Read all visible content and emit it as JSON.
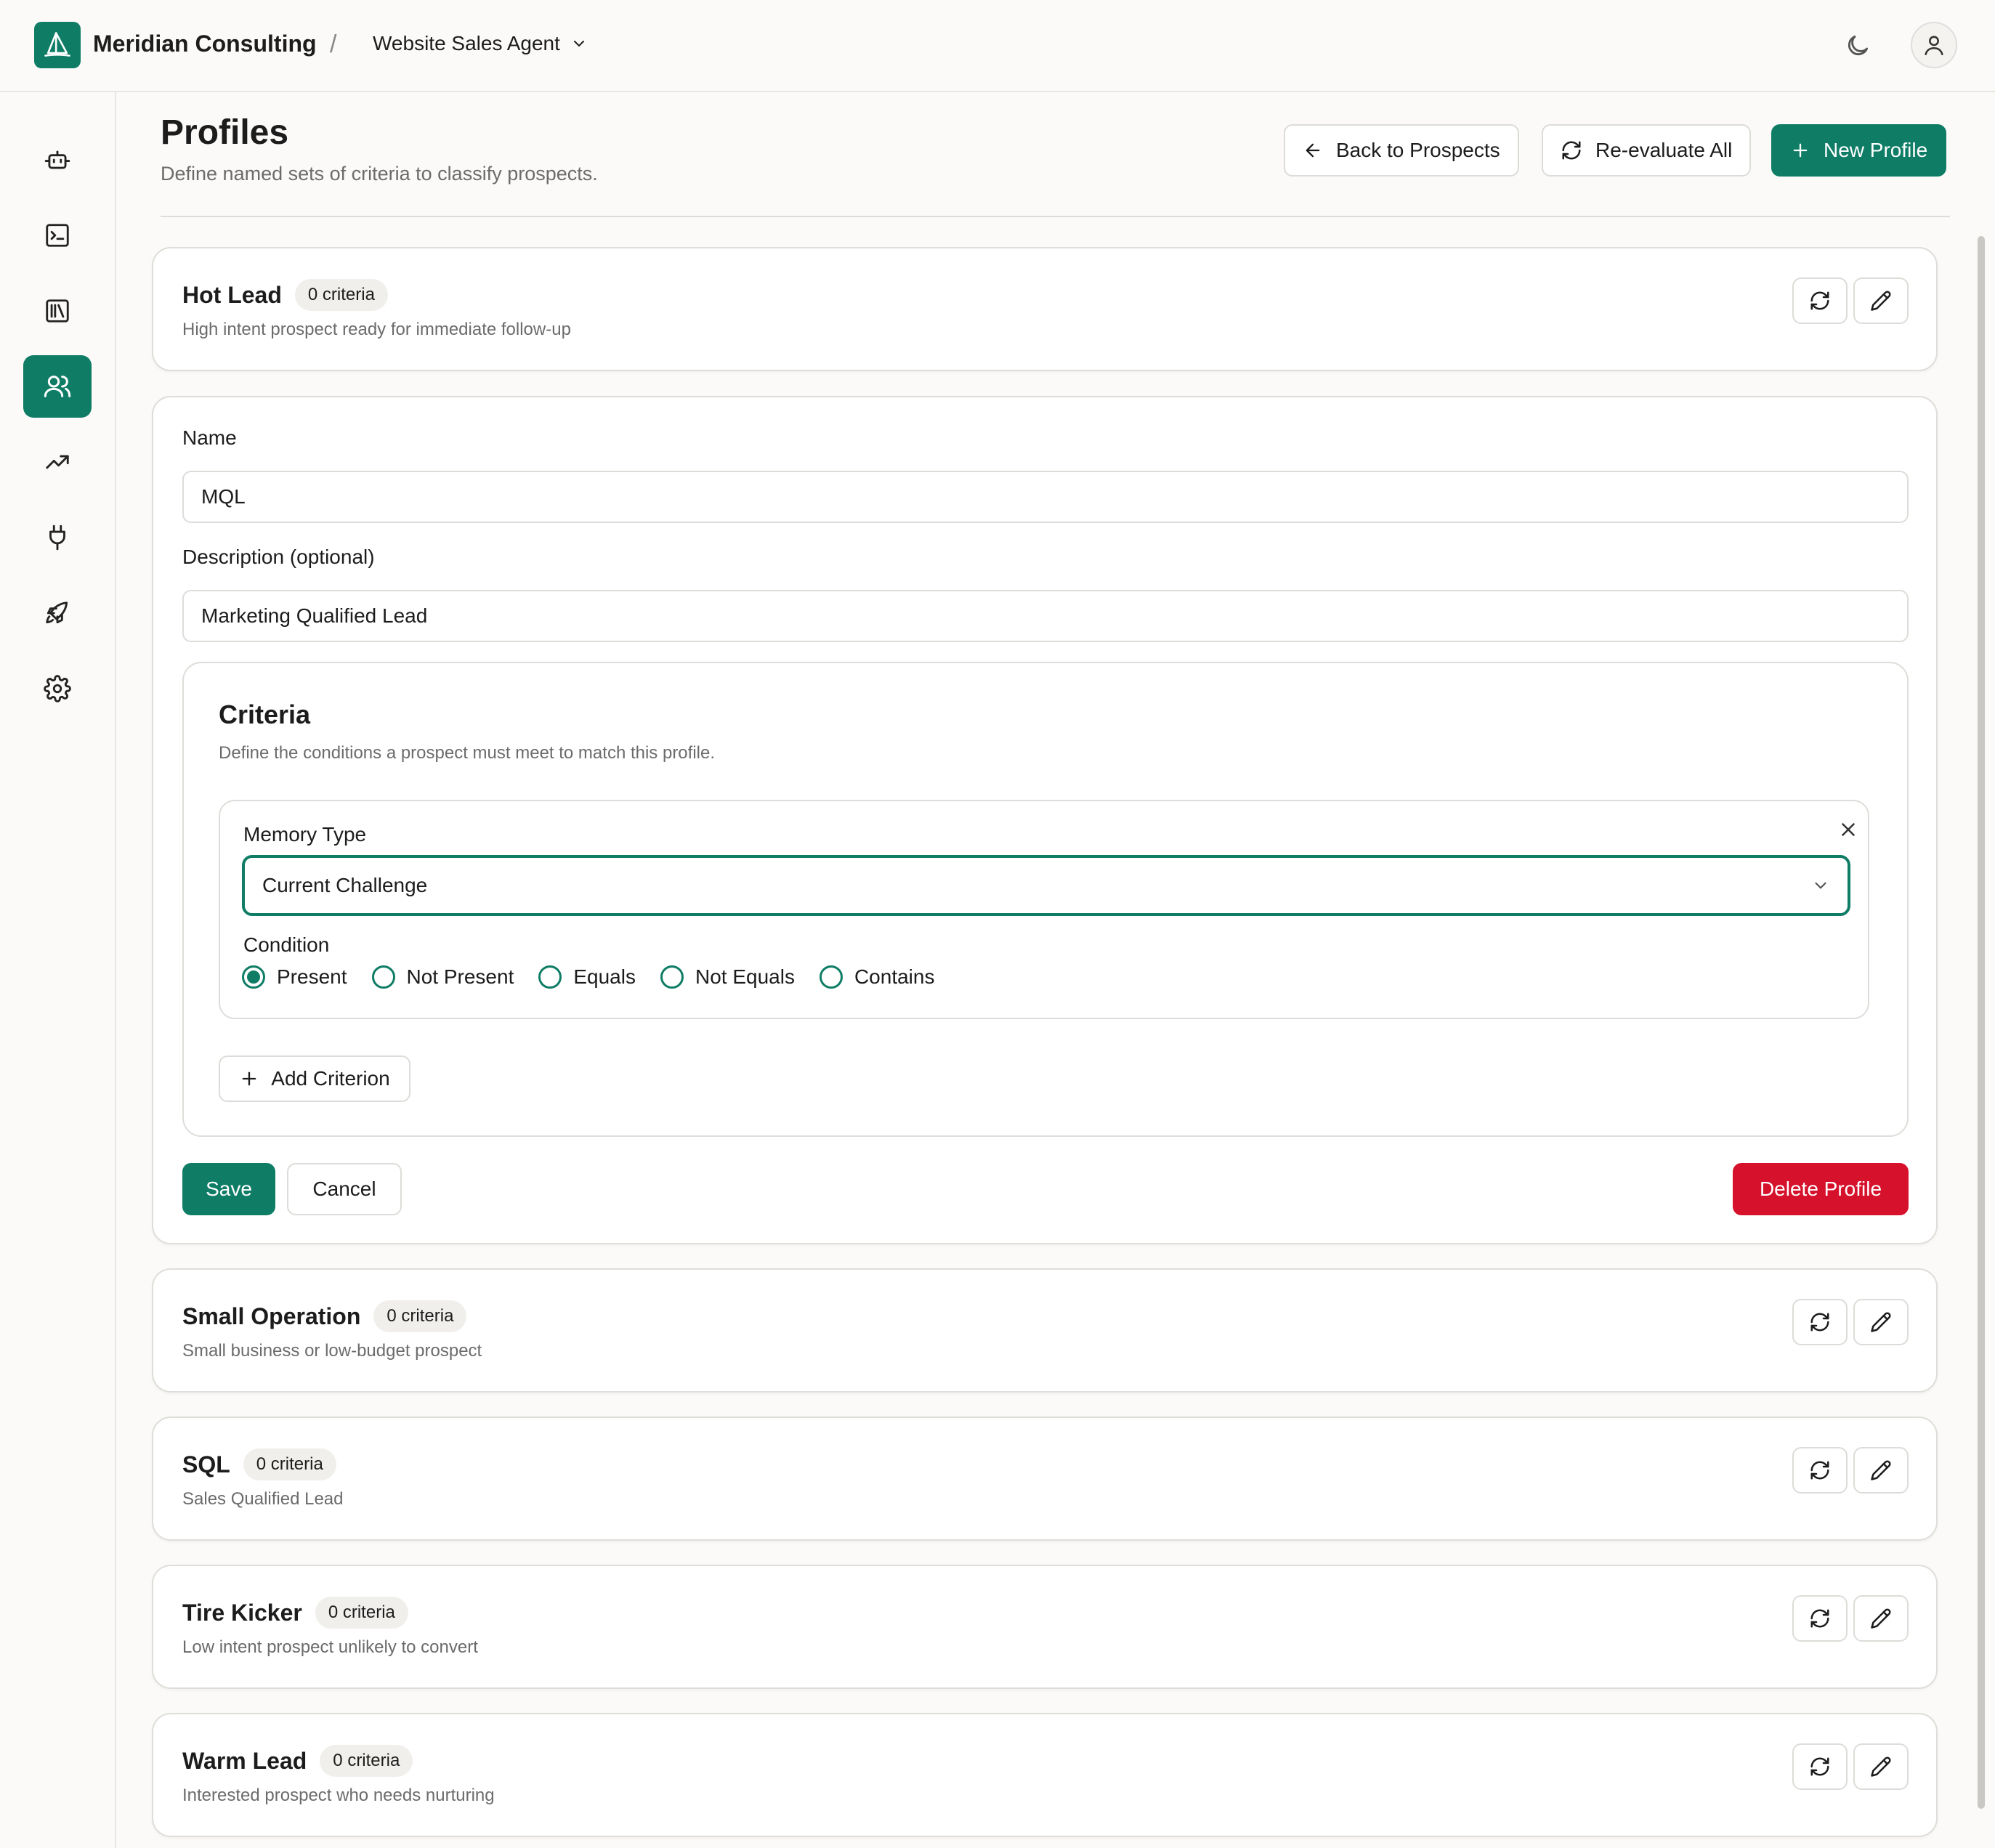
{
  "header": {
    "org_name": "Meridian Consulting",
    "separator": "/",
    "agent_name": "Website Sales Agent"
  },
  "sidebar": {
    "items": [
      {
        "icon": "bot-icon",
        "active": false
      },
      {
        "icon": "terminal-icon",
        "active": false
      },
      {
        "icon": "library-icon",
        "active": false
      },
      {
        "icon": "users-icon",
        "active": true
      },
      {
        "icon": "trending-up-icon",
        "active": false
      },
      {
        "icon": "plug-icon",
        "active": false
      },
      {
        "icon": "rocket-icon",
        "active": false
      },
      {
        "icon": "settings-icon",
        "active": false
      }
    ]
  },
  "page": {
    "title": "Profiles",
    "subtitle": "Define named sets of criteria to classify prospects.",
    "back_label": "Back to Prospects",
    "reevaluate_label": "Re-evaluate All",
    "new_profile_label": "New Profile"
  },
  "profiles": [
    {
      "name": "Hot Lead",
      "badge": "0 criteria",
      "description": "High intent prospect ready for immediate follow-up"
    },
    {
      "name": "Small Operation",
      "badge": "0 criteria",
      "description": "Small business or low-budget prospect"
    },
    {
      "name": "SQL",
      "badge": "0 criteria",
      "description": "Sales Qualified Lead"
    },
    {
      "name": "Tire Kicker",
      "badge": "0 criteria",
      "description": "Low intent prospect unlikely to convert"
    },
    {
      "name": "Warm Lead",
      "badge": "0 criteria",
      "description": "Interested prospect who needs nurturing"
    }
  ],
  "edit_form": {
    "name_label": "Name",
    "name_value": "MQL",
    "description_label": "Description (optional)",
    "description_value": "Marketing Qualified Lead",
    "criteria_title": "Criteria",
    "criteria_subtitle": "Define the conditions a prospect must meet to match this profile.",
    "criterion": {
      "memory_type_label": "Memory Type",
      "memory_type_value": "Current Challenge",
      "condition_label": "Condition",
      "conditions": [
        "Present",
        "Not Present",
        "Equals",
        "Not Equals",
        "Contains"
      ],
      "selected_condition": "Present"
    },
    "add_criterion_label": "Add Criterion",
    "save_label": "Save",
    "cancel_label": "Cancel",
    "delete_label": "Delete Profile"
  },
  "colors": {
    "accent": "#0f7d66",
    "danger": "#d5112b",
    "background": "#fbfaf8"
  }
}
